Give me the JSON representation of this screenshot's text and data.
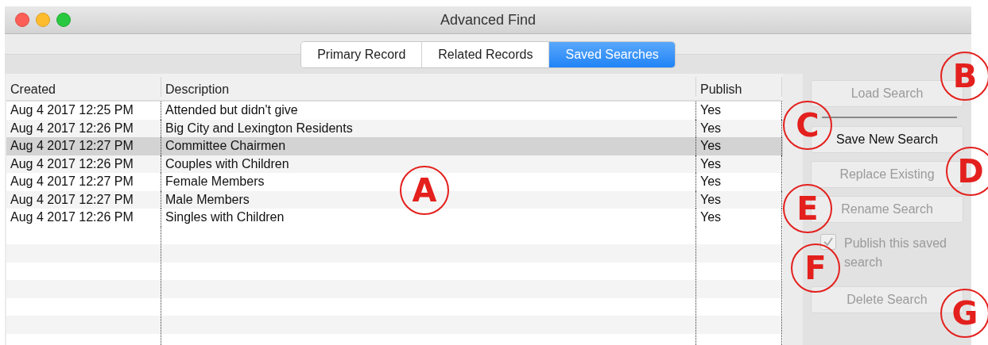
{
  "window": {
    "title": "Advanced Find"
  },
  "tabs": [
    {
      "label": "Primary Record",
      "selected": false
    },
    {
      "label": "Related Records",
      "selected": false
    },
    {
      "label": "Saved Searches",
      "selected": true
    }
  ],
  "table": {
    "columns": [
      "Created",
      "Description",
      "Publish"
    ],
    "rows": [
      {
        "created": "Aug 4 2017 12:25 PM",
        "description": "Attended but didn't give",
        "publish": "Yes",
        "selected": false
      },
      {
        "created": "Aug 4 2017 12:26 PM",
        "description": "Big City and Lexington Residents",
        "publish": "Yes",
        "selected": false
      },
      {
        "created": "Aug 4 2017 12:27 PM",
        "description": "Committee Chairmen",
        "publish": "Yes",
        "selected": true
      },
      {
        "created": "Aug 4 2017 12:26 PM",
        "description": "Couples with Children",
        "publish": "Yes",
        "selected": false
      },
      {
        "created": "Aug 4 2017 12:27 PM",
        "description": "Female Members",
        "publish": "Yes",
        "selected": false
      },
      {
        "created": "Aug 4 2017 12:27 PM",
        "description": "Male Members",
        "publish": "Yes",
        "selected": false
      },
      {
        "created": "Aug 4 2017 12:26 PM",
        "description": "Singles with Children",
        "publish": "Yes",
        "selected": false
      }
    ]
  },
  "actions": [
    {
      "kind": "button",
      "label": "Load Search",
      "disabled": true
    },
    {
      "kind": "separator"
    },
    {
      "kind": "button",
      "label": "Save New Search",
      "disabled": false
    },
    {
      "kind": "button",
      "label": "Replace Existing",
      "disabled": true
    },
    {
      "kind": "button",
      "label": "Rename Search",
      "disabled": true
    },
    {
      "kind": "checkbox",
      "label": "Publish this saved search",
      "checked": true,
      "disabled": true
    },
    {
      "kind": "button",
      "label": "Delete Search",
      "disabled": true
    }
  ],
  "callouts": [
    "A",
    "B",
    "C",
    "D",
    "E",
    "F",
    "G"
  ]
}
